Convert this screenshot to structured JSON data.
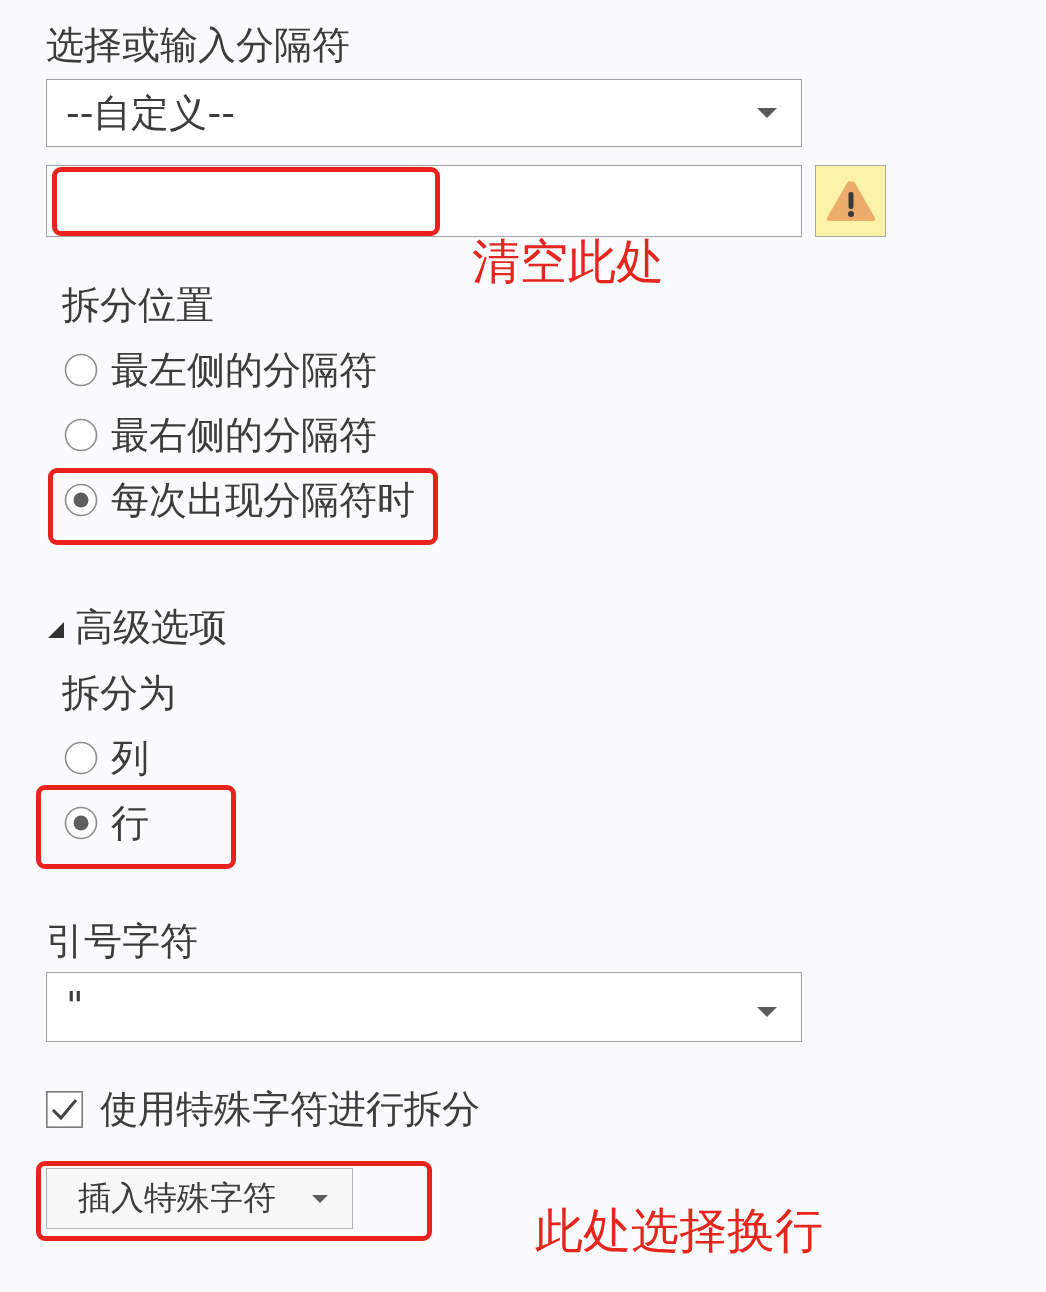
{
  "separator": {
    "label": "选择或输入分隔符",
    "dropdown": {
      "value": "--自定义--"
    },
    "custom_field": {
      "highlighted": true,
      "note": "清空此处"
    }
  },
  "split_position": {
    "label": "拆分位置",
    "options": [
      {
        "label": "最左侧的分隔符",
        "selected": false,
        "highlighted": false
      },
      {
        "label": "最右侧的分隔符",
        "selected": false,
        "highlighted": false
      },
      {
        "label": "每次出现分隔符时",
        "selected": true,
        "highlighted": true
      }
    ]
  },
  "advanced": {
    "title": "高级选项",
    "expanded": true,
    "split_into": {
      "label": "拆分为",
      "options": [
        {
          "label": "列",
          "selected": false,
          "highlighted": false
        },
        {
          "label": "行",
          "selected": true,
          "highlighted": true
        }
      ]
    },
    "quote_char": {
      "label": "引号字符",
      "dropdown": {
        "value": "\""
      }
    },
    "special_chars": {
      "label": "使用特殊字符进行拆分",
      "checked": true
    },
    "insert_button": {
      "label": "插入特殊字符",
      "highlighted": true,
      "note": "此处选择换行"
    }
  }
}
